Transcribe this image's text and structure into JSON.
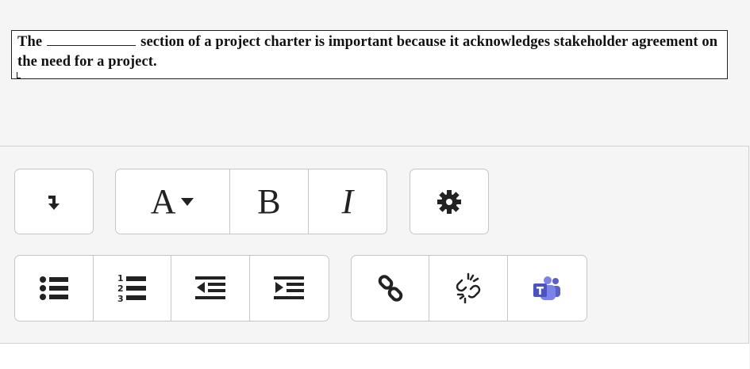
{
  "question": {
    "part1": "The",
    "part2": "section of a project charter is important because it acknowledges stakeholder agreement on the need for a project."
  },
  "toolbar": {
    "font_button_label": "A",
    "bold_label": "B",
    "italic_label": "I",
    "icons": [
      "expand-toolbar-icon",
      "font-color-icon",
      "bold-icon",
      "italic-icon",
      "settings-gear-icon",
      "bullet-list-icon",
      "numbered-list-icon",
      "outdent-icon",
      "indent-icon",
      "link-icon",
      "unlink-icon",
      "teams-icon"
    ],
    "colors": {
      "icon": "#222222",
      "teams_purple": "#5b5fc7",
      "border": "#c6c6c6"
    }
  }
}
